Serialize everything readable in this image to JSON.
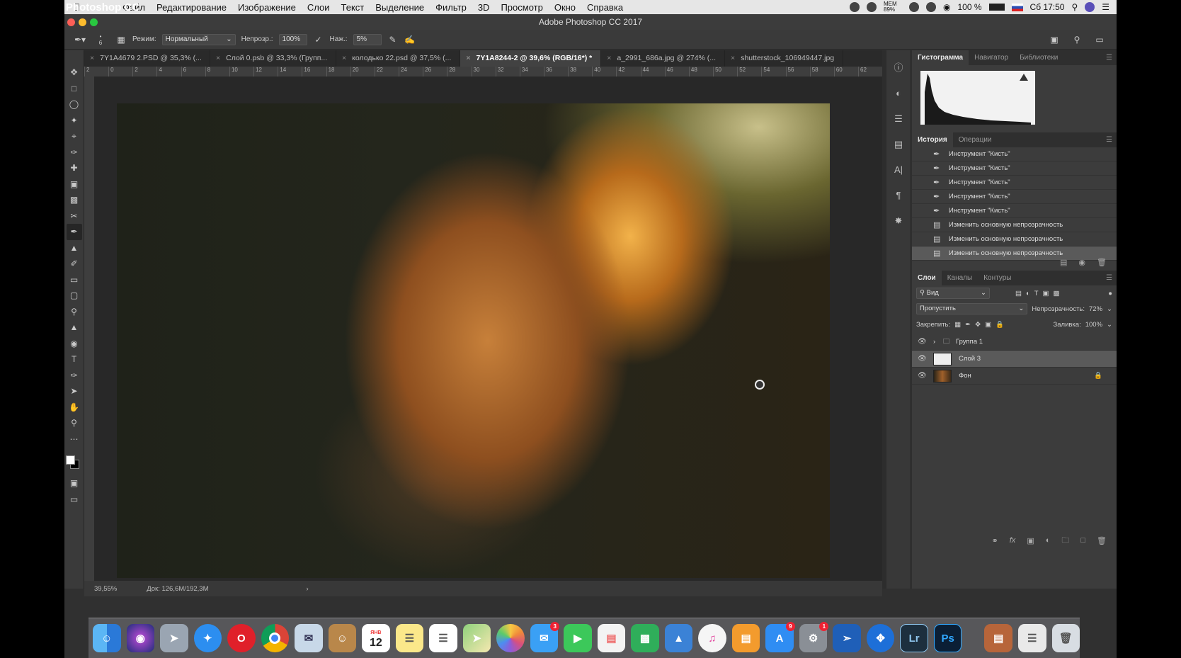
{
  "menubar": {
    "app": "Photoshop CC",
    "items": [
      "Файл",
      "Редактирование",
      "Изображение",
      "Слои",
      "Текст",
      "Выделение",
      "Фильтр",
      "3D",
      "Просмотр",
      "Окно",
      "Справка"
    ],
    "battery": "100 %",
    "clock": "Сб 17:50",
    "mem": "МЕМ 89%"
  },
  "window": {
    "title": "Adobe Photoshop CC 2017"
  },
  "options": {
    "brush_size": "6",
    "mode_label": "Режим:",
    "mode_value": "Нормальный",
    "opacity_label": "Непрозр.:",
    "opacity_value": "100%",
    "flow_label": "Наж.:",
    "flow_value": "5%"
  },
  "tabs": [
    {
      "label": "7Y1A4679 2.PSD @ 35,3% (..."
    },
    {
      "label": "Слой 0.psb @ 33,3% (Групп..."
    },
    {
      "label": "колодько 22.psd @ 37,5% (..."
    },
    {
      "label": "7Y1A8244-2 @ 39,6% (RGB/16*) *"
    },
    {
      "label": "a_2991_686a.jpg @ 274% (..."
    },
    {
      "label": "shutterstock_106949447.jpg"
    }
  ],
  "ruler_ticks": [
    "2",
    "0",
    "2",
    "4",
    "6",
    "8",
    "10",
    "12",
    "14",
    "16",
    "18",
    "20",
    "22",
    "24",
    "26",
    "28",
    "30",
    "32",
    "34",
    "36",
    "38",
    "40",
    "42",
    "44",
    "46",
    "48",
    "50",
    "52",
    "54",
    "56",
    "58",
    "60",
    "62"
  ],
  "status": {
    "zoom": "39,55%",
    "doc": "Док: 126,6M/192,3M"
  },
  "histogram_panel": {
    "tabs": [
      "Гистограмма",
      "Навигатор",
      "Библиотеки"
    ]
  },
  "history_panel": {
    "tabs": [
      "История",
      "Операции"
    ],
    "items": [
      "Инструмент \"Кисть\"",
      "Инструмент \"Кисть\"",
      "Инструмент \"Кисть\"",
      "Инструмент \"Кисть\"",
      "Инструмент \"Кисть\"",
      "Изменить основную непрозрачность",
      "Изменить основную непрозрачность",
      "Изменить основную непрозрачность"
    ]
  },
  "layers_panel": {
    "tabs": [
      "Слои",
      "Каналы",
      "Контуры"
    ],
    "filter": "Вид",
    "blend_mode": "Пропустить",
    "opacity_label": "Непрозрачность:",
    "opacity_value": "72%",
    "lock_label": "Закрепить:",
    "fill_label": "Заливка:",
    "fill_value": "100%",
    "layers": [
      "Группа 1",
      "Слой 3",
      "Фон"
    ]
  },
  "dock": {
    "calendar_day": "12",
    "calendar_month": "ЯНВ",
    "badge_mail": "3",
    "badge_store": "9",
    "badge_prefs": "1",
    "lr": "Lr",
    "ps": "Ps"
  },
  "colors": {
    "accent": "#3a8fd8",
    "panel": "#3c3c3c"
  }
}
